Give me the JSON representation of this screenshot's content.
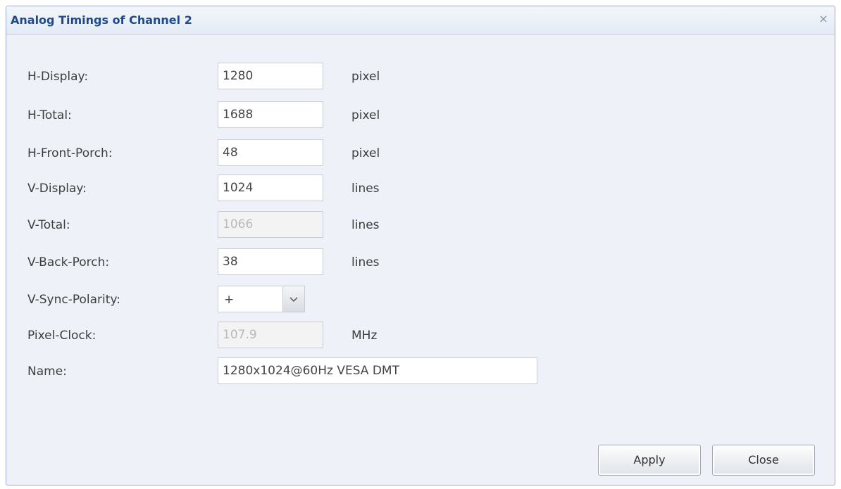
{
  "dialog": {
    "title": "Analog Timings of Channel 2",
    "close_glyph": "×"
  },
  "fields": [
    {
      "label": "H-Display:",
      "value": "1280",
      "unit": "pixel",
      "disabled": false
    },
    {
      "label": "H-Total:",
      "value": "1688",
      "unit": "pixel",
      "disabled": false
    },
    {
      "label": "H-Front-Porch:",
      "value": "48",
      "unit": "pixel",
      "disabled": false
    },
    {
      "label": "V-Display:",
      "value": "1024",
      "unit": "lines",
      "disabled": false
    },
    {
      "label": "V-Total:",
      "value": "1066",
      "unit": "lines",
      "disabled": true
    },
    {
      "label": "V-Back-Porch:",
      "value": "38",
      "unit": "lines",
      "disabled": false
    }
  ],
  "sync_polarity": {
    "label": "V-Sync-Polarity:",
    "value": "+",
    "arrow_icon": "chevron-down-icon"
  },
  "pixel_clock": {
    "label": "Pixel-Clock:",
    "value": "107.9",
    "unit": "MHz",
    "disabled": true
  },
  "name": {
    "label": "Name:",
    "value": "1280x1024@60Hz VESA DMT"
  },
  "buttons": {
    "apply_label": "Apply",
    "close_label": "Close"
  },
  "colors": {
    "title": "#1f4a8a",
    "background": "#eef2f8"
  }
}
